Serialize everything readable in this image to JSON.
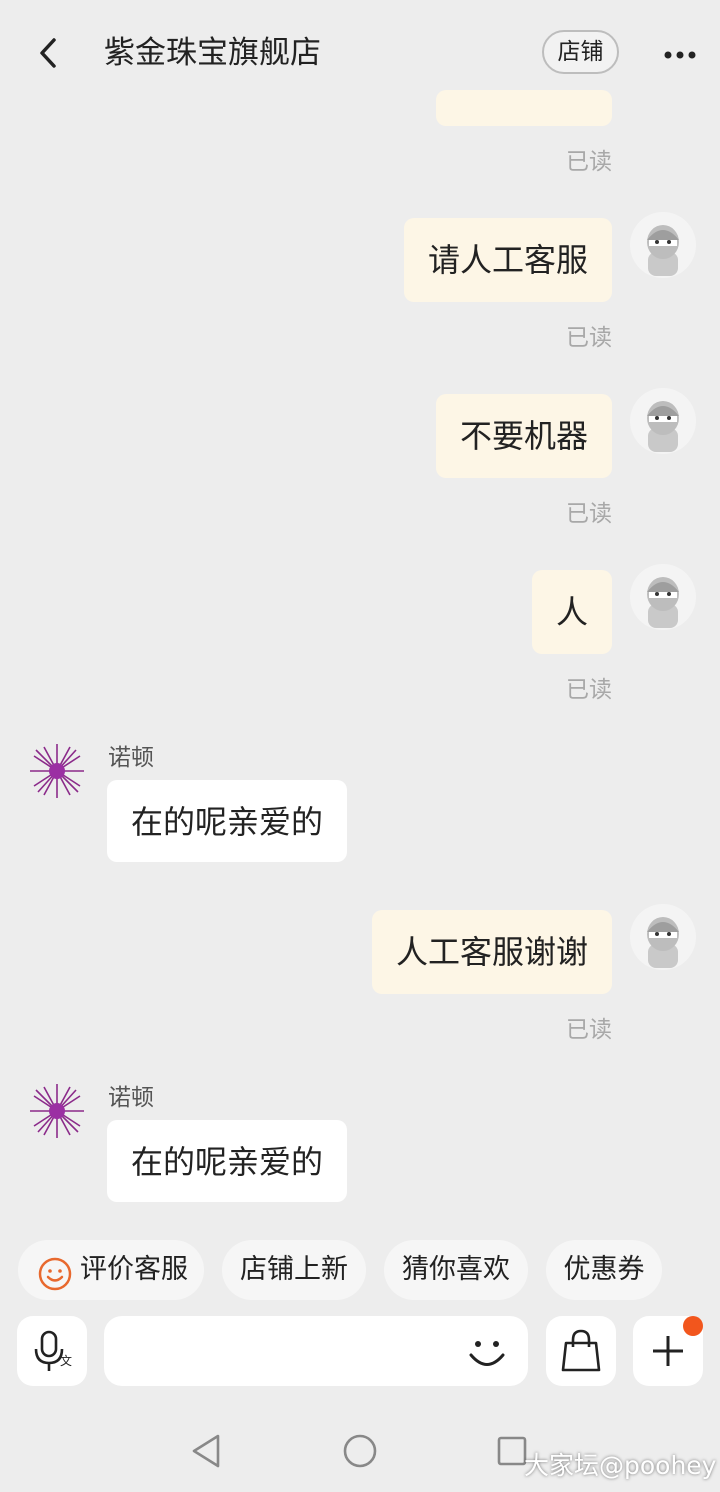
{
  "header": {
    "title": "紫金珠宝旗舰店",
    "store_label": "店铺"
  },
  "messages": {
    "read_label": "已读",
    "m1": "请人工客服",
    "m2": "不要机器",
    "m3": "人",
    "agent_name": "诺顿",
    "agent_reply": "在的呢亲爱的",
    "m4": "人工客服谢谢"
  },
  "quick_actions": [
    "评价客服",
    "店铺上新",
    "猜你喜欢",
    "优惠券"
  ],
  "input": {
    "placeholder": ""
  },
  "watermark": "大家坛@poohey",
  "colors": {
    "accent_orange": "#e8692e",
    "badge": "#f2561d",
    "bubble_self": "#fdf6e6",
    "bubble_agent": "#ffffff",
    "background": "#ededed"
  }
}
